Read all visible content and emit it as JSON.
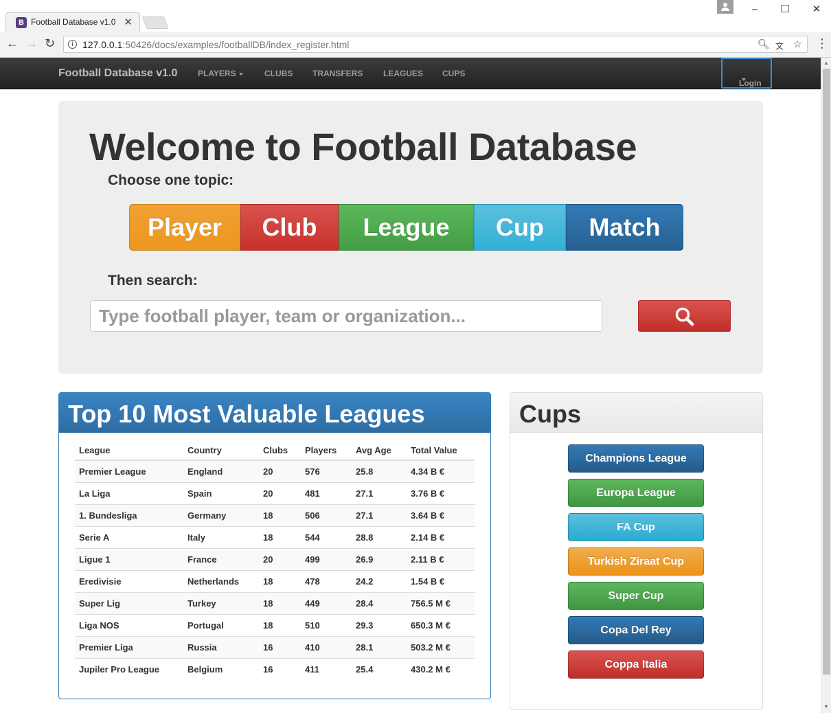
{
  "browser": {
    "tab_title": "Football Database v1.0",
    "tab_icon_letter": "B",
    "url_host": "127.0.0.1",
    "url_rest": ":50426/docs/examples/footballDB/index_register.html"
  },
  "navbar": {
    "brand": "Football Database v1.0",
    "items": [
      "PLAYERS",
      "CLUBS",
      "TRANSFERS",
      "LEAGUES",
      "CUPS"
    ],
    "login": "Login"
  },
  "jumbotron": {
    "title": "Welcome to Football Database",
    "choose_label": "Choose one topic:",
    "topics": [
      "Player",
      "Club",
      "League",
      "Cup",
      "Match"
    ],
    "then_label": "Then search:",
    "search_placeholder": "Type football player, team or organization..."
  },
  "leagues": {
    "title": "Top 10 Most Valuable Leagues",
    "columns": [
      "League",
      "Country",
      "Clubs",
      "Players",
      "Avg Age",
      "Total Value"
    ],
    "rows": [
      [
        "Premier League",
        "England",
        "20",
        "576",
        "25.8",
        "4.34 B €"
      ],
      [
        "La Liga",
        "Spain",
        "20",
        "481",
        "27.1",
        "3.76 B €"
      ],
      [
        "1. Bundesliga",
        "Germany",
        "18",
        "506",
        "27.1",
        "3.64 B €"
      ],
      [
        "Serie A",
        "Italy",
        "18",
        "544",
        "28.8",
        "2.14 B €"
      ],
      [
        "Ligue 1",
        "France",
        "20",
        "499",
        "26.9",
        "2.11 B €"
      ],
      [
        "Eredivisie",
        "Netherlands",
        "18",
        "478",
        "24.2",
        "1.54 B €"
      ],
      [
        "Super Lig",
        "Turkey",
        "18",
        "449",
        "28.4",
        "756.5 M €"
      ],
      [
        "Liga NOS",
        "Portugal",
        "18",
        "510",
        "29.3",
        "650.3 M €"
      ],
      [
        "Premier Liga",
        "Russia",
        "16",
        "410",
        "28.1",
        "503.2 M €"
      ],
      [
        "Jupiler Pro League",
        "Belgium",
        "16",
        "411",
        "25.4",
        "430.2 M €"
      ]
    ]
  },
  "cups": {
    "title": "Cups",
    "items": [
      "Champions League",
      "Europa League",
      "FA Cup",
      "Turkish Ziraat Cup",
      "Super Cup",
      "Copa Del Rey",
      "Coppa Italia"
    ]
  },
  "colors": {
    "primary": "#337ab7",
    "success": "#5cb85c",
    "info": "#5bc0de",
    "warning": "#f0ad4e",
    "danger": "#d9534f"
  }
}
